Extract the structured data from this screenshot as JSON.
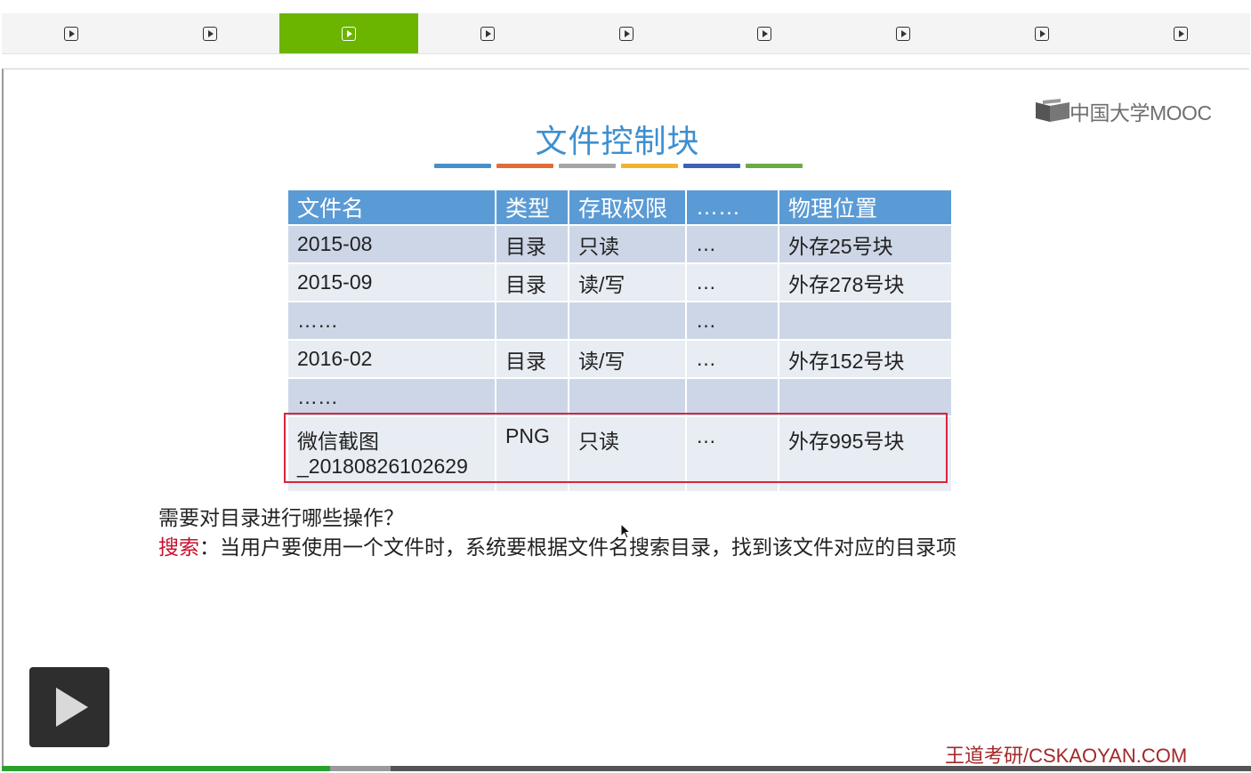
{
  "chapter_tabs": [
    {
      "active": false
    },
    {
      "active": false
    },
    {
      "active": true
    },
    {
      "active": false
    },
    {
      "active": false
    },
    {
      "active": false
    },
    {
      "active": false
    },
    {
      "active": false
    },
    {
      "active": false
    }
  ],
  "logo": {
    "text": "中国大学MOOC"
  },
  "slide": {
    "title": "文件控制块",
    "color_bars": [
      "#4a90c8",
      "#e06c3a",
      "#a5a5a5",
      "#f2b230",
      "#3b62b5",
      "#6aab47"
    ],
    "table": {
      "headers": [
        "文件名",
        "类型",
        "存取权限",
        "……",
        "物理位置"
      ],
      "rows": [
        [
          "2015-08",
          "目录",
          "只读",
          "…",
          "外存25号块"
        ],
        [
          "2015-09",
          "目录",
          "读/写",
          "…",
          "外存278号块"
        ],
        [
          "……",
          "",
          "",
          "…",
          ""
        ],
        [
          "2016-02",
          "目录",
          "读/写",
          "…",
          "外存152号块"
        ],
        [
          "……",
          "",
          "",
          "",
          ""
        ]
      ],
      "highlighted_row": {
        "name_line1": "微信截图",
        "name_line2": "_20180826102629",
        "type": "PNG",
        "permission": "只读",
        "ellipsis": "…",
        "location": "外存995号块"
      }
    },
    "question": "需要对目录进行哪些操作？",
    "answer_keyword": "搜索",
    "answer_rest": "：当用户要使用一个文件时，系统要根据文件名搜索目录，找到该文件对应的目录项",
    "watermark": "王道考研/CSKAOYAN.COM"
  },
  "player": {
    "progress_played": 0.263,
    "progress_buffered": 0.311,
    "accent": "#6bb400"
  }
}
